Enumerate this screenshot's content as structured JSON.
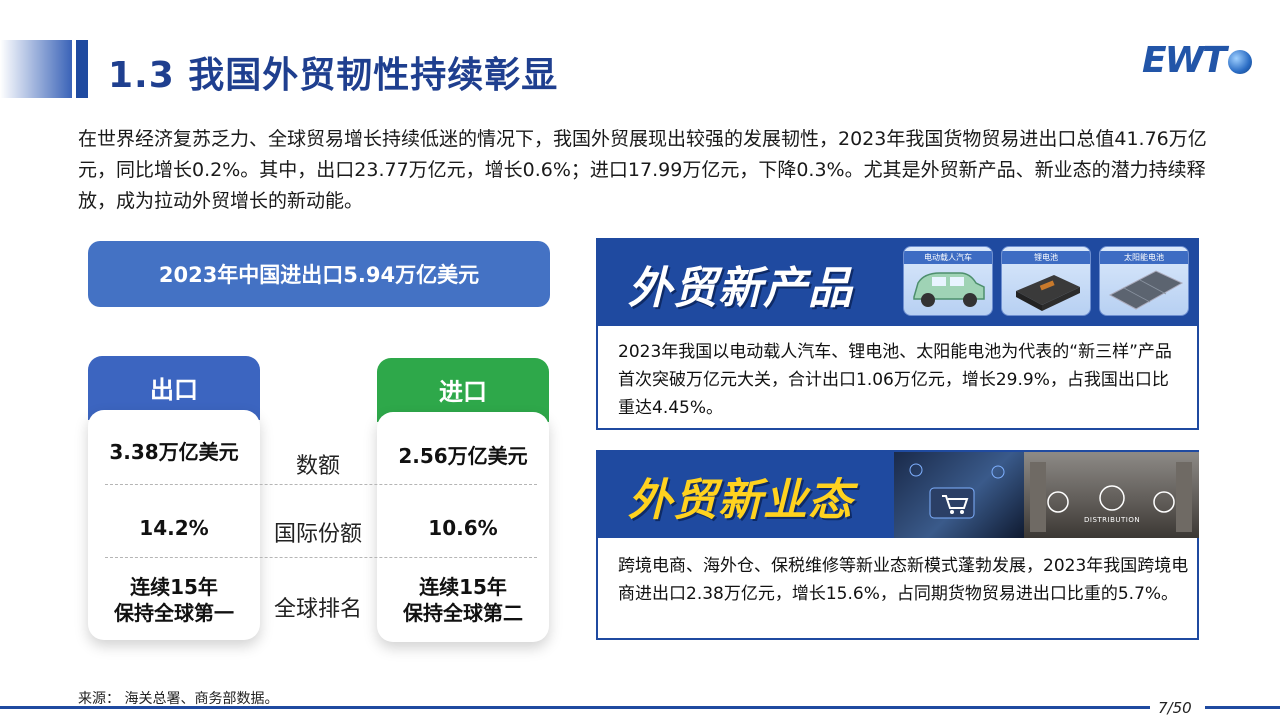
{
  "header": {
    "title": "1.3 我国外贸韧性持续彰显",
    "logo_text": "EWT"
  },
  "intro": "在世界经济复苏乏力、全球贸易增长持续低迷的情况下，我国外贸展现出较强的发展韧性，2023年我国货物贸易进出口总值41.76万亿元，同比增长0.2%。其中，出口23.77万亿元，增长0.6%；进口17.99万亿元，下降0.3%。尤其是外贸新产品、新业态的潜力持续释放，成为拉动外贸增长的新动能。",
  "summary_pill": "2023年中国进出口5.94万亿美元",
  "columns": {
    "export": {
      "label": "出口",
      "amount": "3.38万亿美元",
      "share": "14.2%",
      "rank_line1": "连续15年",
      "rank_line2": "保持全球第一"
    },
    "import": {
      "label": "进口",
      "amount": "2.56万亿美元",
      "share": "10.6%",
      "rank_line1": "连续15年",
      "rank_line2": "保持全球第二"
    }
  },
  "metrics": {
    "amount": "数额",
    "share": "国际份额",
    "rank": "全球排名"
  },
  "new_products": {
    "title": "外贸新产品",
    "thumbs": [
      "电动载人汽车",
      "锂电池",
      "太阳能电池"
    ],
    "desc": "2023年我国以电动载人汽车、锂电池、太阳能电池为代表的“新三样”产品首次突破万亿元大关，合计出口1.06万亿元，增长29.9%，占我国出口比重达4.45%。"
  },
  "new_business": {
    "title": "外贸新业态",
    "photo_label": "DISTRIBUTION",
    "desc": "跨境电商、海外仓、保税维修等新业态新模式蓬勃发展，2023年我国跨境电商进出口2.38万亿元，增长15.6%，占同期货物贸易进出口比重的5.7%。"
  },
  "footer": {
    "source": "来源： 海关总署、商务部数据。",
    "page": "7/50"
  }
}
